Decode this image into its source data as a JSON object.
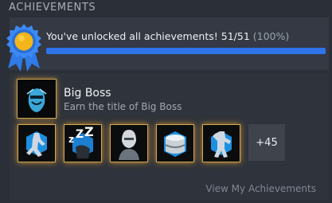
{
  "section": {
    "title": "ACHIEVEMENTS"
  },
  "summary": {
    "message": "You've unlocked all achievements! 51/51",
    "percent_text": "(100%)",
    "progress": 1.0,
    "badge_icon": "ribbon-medal-icon"
  },
  "featured": {
    "name": "Big Boss",
    "description": "Earn the title of Big Boss",
    "icon": "big-boss-achievement-icon"
  },
  "recent_icons": [
    {
      "icon": "soldier-running-achievement-icon"
    },
    {
      "icon": "sleeping-soldier-achievement-icon"
    },
    {
      "icon": "masked-soldier-achievement-icon"
    },
    {
      "icon": "barrel-achievement-icon"
    },
    {
      "icon": "soldier-pose-achievement-icon"
    }
  ],
  "more_count": "+45",
  "footer": {
    "view_link": "View My Achievements"
  },
  "colors": {
    "background": "#2b2f37",
    "progress": "#2e74ea",
    "gold_border": "#d4a850",
    "badge_blue": "#2f7be8",
    "badge_gold": "#f3b51a"
  }
}
